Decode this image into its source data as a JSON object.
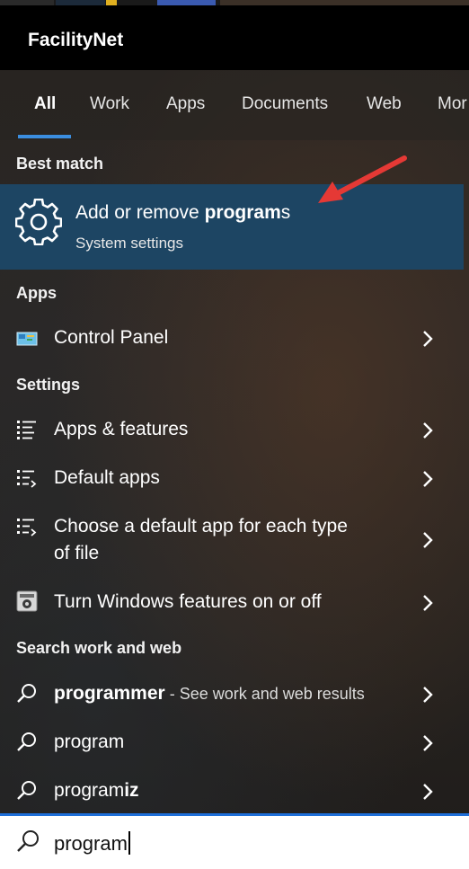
{
  "app": {
    "title": "FacilityNet"
  },
  "tabs": [
    {
      "label": "All",
      "active": true
    },
    {
      "label": "Work"
    },
    {
      "label": "Apps"
    },
    {
      "label": "Documents"
    },
    {
      "label": "Web"
    },
    {
      "label": "Mor"
    }
  ],
  "best_match": {
    "heading": "Best match",
    "title_prefix": "Add or remove ",
    "title_bold": "program",
    "title_suffix": "s",
    "subtitle": "System settings",
    "icon": "gear-icon"
  },
  "apps": {
    "heading": "Apps",
    "items": [
      {
        "label": "Control Panel",
        "icon": "control-panel-icon"
      }
    ]
  },
  "settings": {
    "heading": "Settings",
    "items": [
      {
        "label": "Apps & features",
        "icon": "list-icon"
      },
      {
        "label": "Default apps",
        "icon": "list-arrow-icon"
      },
      {
        "label_line1": "Choose a default app for each type",
        "label_line2": "of file",
        "icon": "list-arrow-icon"
      },
      {
        "label": "Turn Windows features on or off",
        "icon": "windows-features-icon"
      }
    ]
  },
  "web": {
    "heading": "Search work and web",
    "items": [
      {
        "label": "programmer",
        "sub": " - See work and web results"
      },
      {
        "label_prefix": "program",
        "label_suffix": ""
      },
      {
        "label_prefix": "program",
        "label_suffix": "iz"
      }
    ]
  },
  "search": {
    "query": "program"
  },
  "colors": {
    "accent": "#3b8ee0",
    "best_match_bg": "#1d4563",
    "annotation_arrow": "#e53935"
  }
}
